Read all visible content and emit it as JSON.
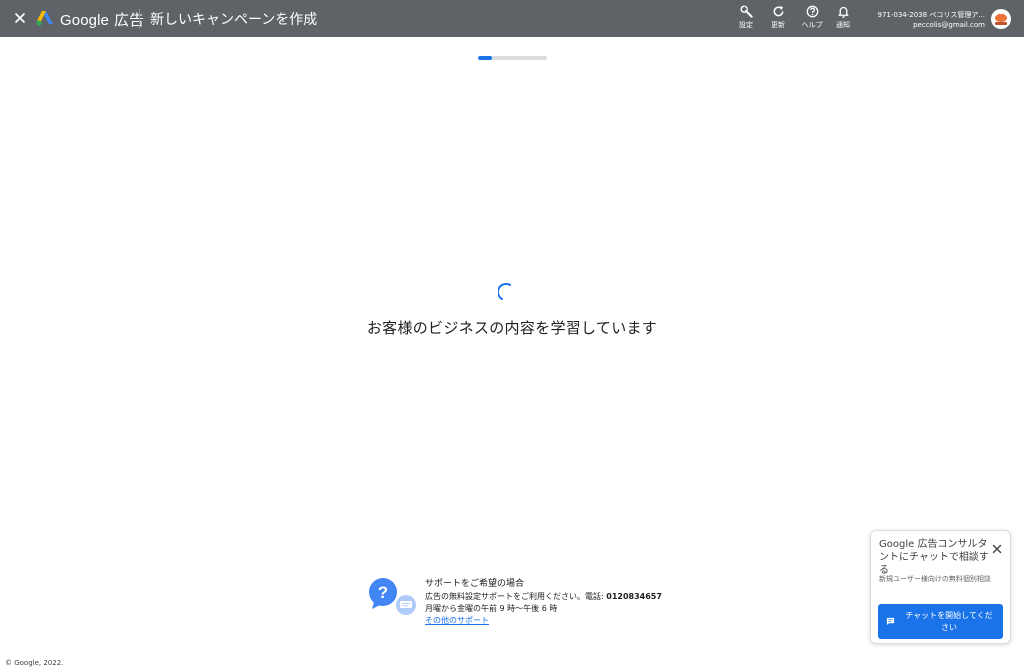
{
  "header": {
    "brand": "Google",
    "brand_suffix": "広告",
    "page_title": "新しいキャンペーンを作成",
    "tools": [
      {
        "icon": "wrench-icon",
        "label": "設定"
      },
      {
        "icon": "refresh-icon",
        "label": "更新"
      },
      {
        "icon": "help-icon",
        "label": "ヘルプ"
      },
      {
        "icon": "bell-icon",
        "label": "通知"
      }
    ],
    "account": {
      "line1": "971-034-2038 ペコリス管理ア...",
      "email": "peccolis@gmail.com"
    }
  },
  "progress": {
    "value": 0.2
  },
  "main": {
    "loading_message": "お客様のビジネスの内容を学習しています"
  },
  "support": {
    "title": "サポートをご希望の場合",
    "line1_prefix": "広告の無料設定サポートをご利用ください。電話: ",
    "phone": "0120834657",
    "line2": "月曜から金曜の午前 9 時〜午後 6 時",
    "other_link": "その他のサポート"
  },
  "footer": {
    "copyright": "© Google, 2022."
  },
  "chat": {
    "title": "Google 広告コンサルタントにチャットで相談する",
    "description": "新規ユーザー様向けの無料個別相談",
    "button_label": "チャットを開始してください"
  },
  "colors": {
    "header_bg": "#5f6368",
    "accent": "#1a73e8"
  }
}
